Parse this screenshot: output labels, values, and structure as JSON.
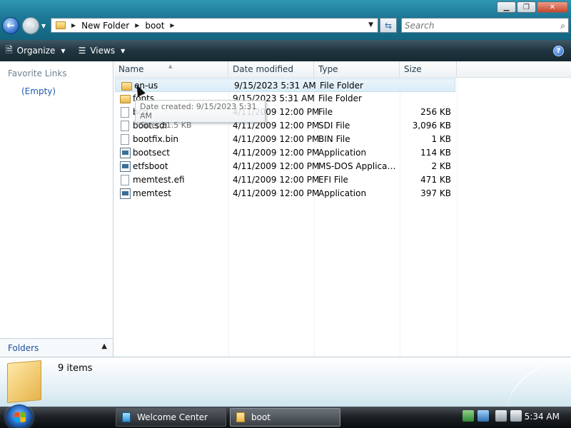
{
  "window": {
    "buttons": {
      "minimize": "▁",
      "maximize": "❐",
      "close": "✕"
    }
  },
  "address": {
    "crumbs": [
      "New Folder",
      "boot"
    ]
  },
  "search": {
    "placeholder": "Search"
  },
  "toolbar": {
    "organize_label": "Organize",
    "views_label": "Views",
    "help_label": "?"
  },
  "leftpane": {
    "favorites_title": "Favorite Links",
    "favorites_empty": "(Empty)",
    "folders_label": "Folders"
  },
  "columns": [
    "Name",
    "Date modified",
    "Type",
    "Size"
  ],
  "files": [
    {
      "name": "en-us",
      "date": "9/15/2023 5:31 AM",
      "type": "File Folder",
      "size": "",
      "icon": "folder-icon"
    },
    {
      "name": "fonts",
      "date": "9/15/2023 5:31 AM",
      "type": "File Folder",
      "size": "",
      "icon": "folder-icon"
    },
    {
      "name": "bcd",
      "date": "4/11/2009 12:00 PM",
      "type": "File",
      "size": "256 KB",
      "icon": "file-icon"
    },
    {
      "name": "boot.sdi",
      "date": "4/11/2009 12:00 PM",
      "type": "SDI File",
      "size": "3,096 KB",
      "icon": "file-icon"
    },
    {
      "name": "bootfix.bin",
      "date": "4/11/2009 12:00 PM",
      "type": "BIN File",
      "size": "1 KB",
      "icon": "file-icon"
    },
    {
      "name": "bootsect",
      "date": "4/11/2009 12:00 PM",
      "type": "Application",
      "size": "114 KB",
      "icon": "application-icon"
    },
    {
      "name": "etfsboot",
      "date": "4/11/2009 12:00 PM",
      "type": "MS-DOS Applicati...",
      "size": "2 KB",
      "icon": "application-icon"
    },
    {
      "name": "memtest.efi",
      "date": "4/11/2009 12:00 PM",
      "type": "EFI File",
      "size": "471 KB",
      "icon": "file-icon"
    },
    {
      "name": "memtest",
      "date": "4/11/2009 12:00 PM",
      "type": "Application",
      "size": "397 KB",
      "icon": "application-icon"
    }
  ],
  "tooltip": {
    "line1": "Date created: 9/15/2023 5:31 AM",
    "line2": "Size: 21.5 KB"
  },
  "details": {
    "item_count": "9 items"
  },
  "taskbar": {
    "buttons": [
      {
        "label": "Welcome Center"
      },
      {
        "label": "boot"
      }
    ],
    "clock": "5:34 AM"
  }
}
